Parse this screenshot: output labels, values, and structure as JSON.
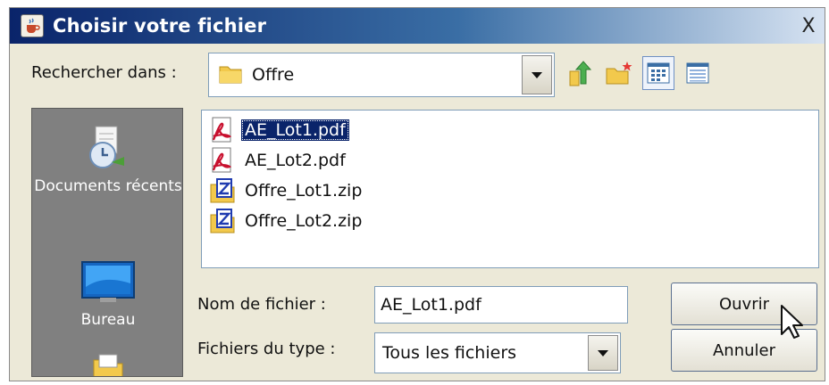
{
  "window": {
    "title": "Choisir votre fichier",
    "close_glyph": "X"
  },
  "lookin": {
    "label": "Rechercher dans :",
    "value": "Offre"
  },
  "toolbar": [
    {
      "icon": "up-folder-icon"
    },
    {
      "icon": "new-folder-icon"
    },
    {
      "icon": "list-view-icon"
    },
    {
      "icon": "details-view-icon"
    }
  ],
  "places": [
    {
      "label": "Documents récents",
      "icon": "recent-documents-icon"
    },
    {
      "label": "Bureau",
      "icon": "desktop-icon"
    },
    {
      "label": "",
      "icon": "folder-icon"
    }
  ],
  "files": [
    {
      "name": "AE_Lot1.pdf",
      "type": "pdf",
      "selected": true
    },
    {
      "name": "AE_Lot2.pdf",
      "type": "pdf",
      "selected": false
    },
    {
      "name": "Offre_Lot1.zip",
      "type": "zip",
      "selected": false
    },
    {
      "name": "Offre_Lot2.zip",
      "type": "zip",
      "selected": false
    }
  ],
  "filename": {
    "label": "Nom de fichier :",
    "value": "AE_Lot1.pdf"
  },
  "filetype": {
    "label": "Fichiers du type :",
    "value": "Tous les fichiers"
  },
  "buttons": {
    "open": "Ouvrir",
    "cancel": "Annuler"
  },
  "colors": {
    "titlebar": "#0a246a",
    "selection": "#0a246a",
    "pdf_red": "#c8102e",
    "zip_blue": "#1f3bb0",
    "folder_yellow": "#f2c94c"
  }
}
